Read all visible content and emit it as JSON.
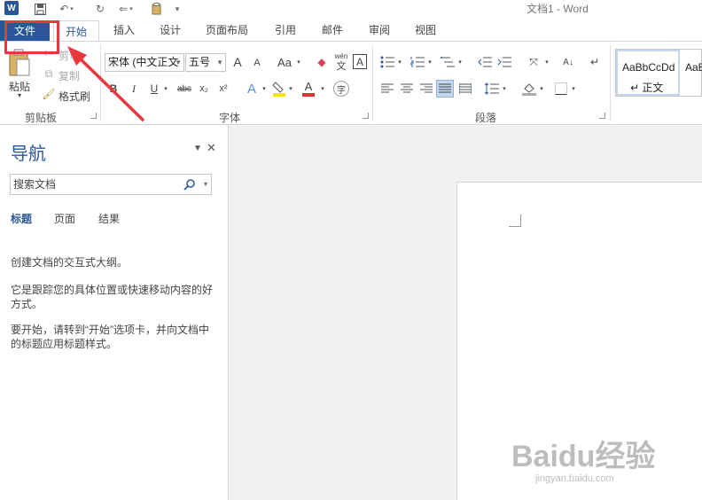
{
  "titlebar": {
    "app_title": "文档1 - Word",
    "logo": "W",
    "qat_icons": [
      "word-logo-icon",
      "save-icon",
      "undo-icon",
      "redo-icon",
      "touch-mode-icon",
      "paste-qat-icon",
      "customize-qat-icon"
    ]
  },
  "tabs": {
    "file": "文件",
    "home": "开始",
    "insert": "插入",
    "design": "设计",
    "layout": "页面布局",
    "references": "引用",
    "mailings": "邮件",
    "review": "审阅",
    "view": "视图"
  },
  "ribbon": {
    "clipboard": {
      "paste": "粘贴",
      "cut": "剪切",
      "copy": "复制",
      "format_painter": "格式刷",
      "group_label": "剪贴板"
    },
    "font": {
      "font_name": "宋体 (中文正文",
      "font_size": "五号",
      "grow_font": "A",
      "shrink_font": "A",
      "change_case": "Aa",
      "phonetic": "wén",
      "phonetic_char": "文",
      "char_border": "A",
      "bold": "B",
      "italic": "I",
      "underline": "U",
      "strikethrough": "abc",
      "subscript": "x₂",
      "superscript": "x²",
      "text_effects": "A",
      "font_color": "A",
      "enclose_char": "字",
      "group_label": "字体"
    },
    "paragraph": {
      "group_label": "段落"
    },
    "styles": {
      "normal_preview": "AaBbCcDd",
      "normal_label": "↵ 正文",
      "next_preview": "AaB"
    }
  },
  "nav_pane": {
    "title": "导航",
    "search_placeholder": "搜索文档",
    "tabs": [
      "标题",
      "页面",
      "结果"
    ],
    "text1": "创建文档的交互式大纲。",
    "text2": "它是跟踪您的具体位置或快速移动内容的好方式。",
    "text3": "要开始，请转到“开始”选项卡，并向文档中的标题应用标题样式。"
  },
  "watermark": {
    "brand": "Baidu经验",
    "url": "jingyan.baidu.com"
  },
  "colors": {
    "accent": "#2b579a",
    "annotation": "#e8373e"
  }
}
